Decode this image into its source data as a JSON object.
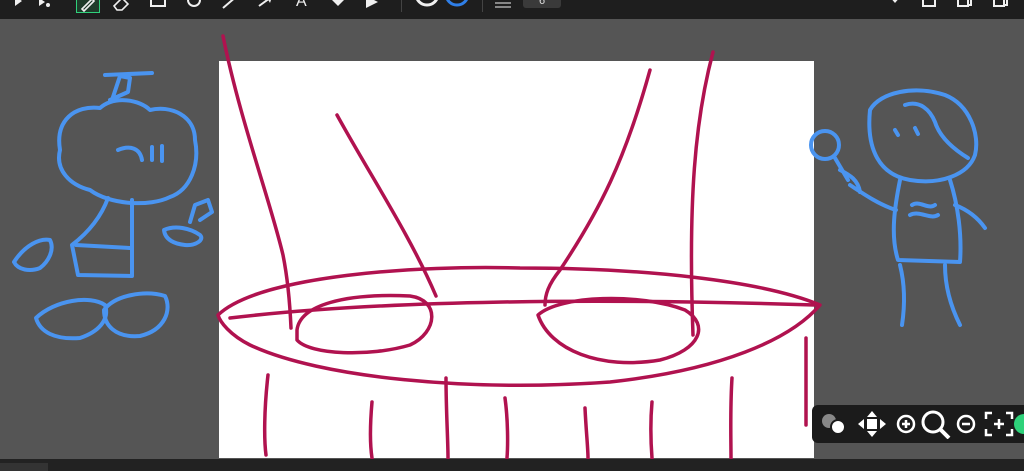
{
  "toolbar": {
    "tools": [
      {
        "name": "select-arrow-icon"
      },
      {
        "name": "select-arrow-small-icon"
      },
      {
        "name": "pen-icon",
        "active": true
      },
      {
        "name": "eraser-icon"
      },
      {
        "name": "rectangle-icon"
      },
      {
        "name": "ellipse-icon"
      },
      {
        "name": "line-icon"
      },
      {
        "name": "arrow-icon"
      },
      {
        "name": "text-icon"
      },
      {
        "name": "fill-icon"
      },
      {
        "name": "pointer-icon"
      }
    ],
    "stroke_color": "#f0f0f0",
    "fill_color": "#2f7fe8",
    "thickness_value": "6",
    "right_icons": [
      "dropdown-arrow-icon",
      "trash-icon",
      "copy-icon",
      "paste-icon"
    ],
    "active_accent": "#2fd07a"
  },
  "canvas": {
    "background": "#555555",
    "paper_color": "#ffffff",
    "ink_magenta": "#b0124f",
    "ink_blue": "#4a94f0"
  },
  "nav_panel": {
    "buttons": [
      {
        "name": "layers-icon"
      },
      {
        "name": "move-icon"
      },
      {
        "name": "zoom-in-icon"
      },
      {
        "name": "zoom-icon"
      },
      {
        "name": "zoom-out-icon"
      },
      {
        "name": "fit-to-screen-icon"
      }
    ],
    "accent_color": "#2ed27a"
  }
}
